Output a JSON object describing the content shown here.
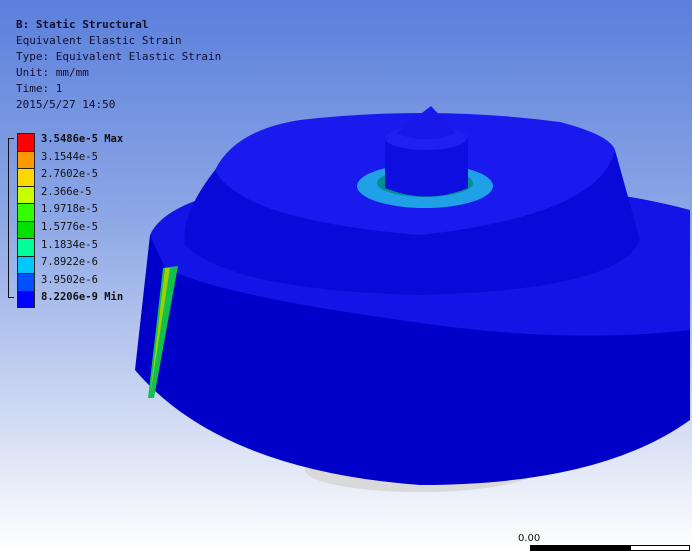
{
  "header": {
    "title": "B: Static Structural",
    "result": "Equivalent Elastic Strain",
    "type": "Type: Equivalent Elastic Strain",
    "unit": "Unit: mm/mm",
    "time": "Time: 1",
    "date": "2015/5/27 14:50"
  },
  "legend": {
    "max_label": "3.5486e-5 Max",
    "values": [
      "3.1544e-5",
      "2.7602e-5",
      "2.366e-5",
      "1.9718e-5",
      "1.5776e-5",
      "1.1834e-5",
      "7.8922e-6",
      "3.9502e-6"
    ],
    "min_label": "8.2206e-9 Min",
    "colors": [
      "#ff0000",
      "#ff9900",
      "#ffd700",
      "#c8ff00",
      "#33ff00",
      "#00e000",
      "#00ff99",
      "#00c8ff",
      "#0050ff",
      "#0000ff",
      "#e6e6e6"
    ]
  },
  "scale": {
    "label": "0.00"
  }
}
